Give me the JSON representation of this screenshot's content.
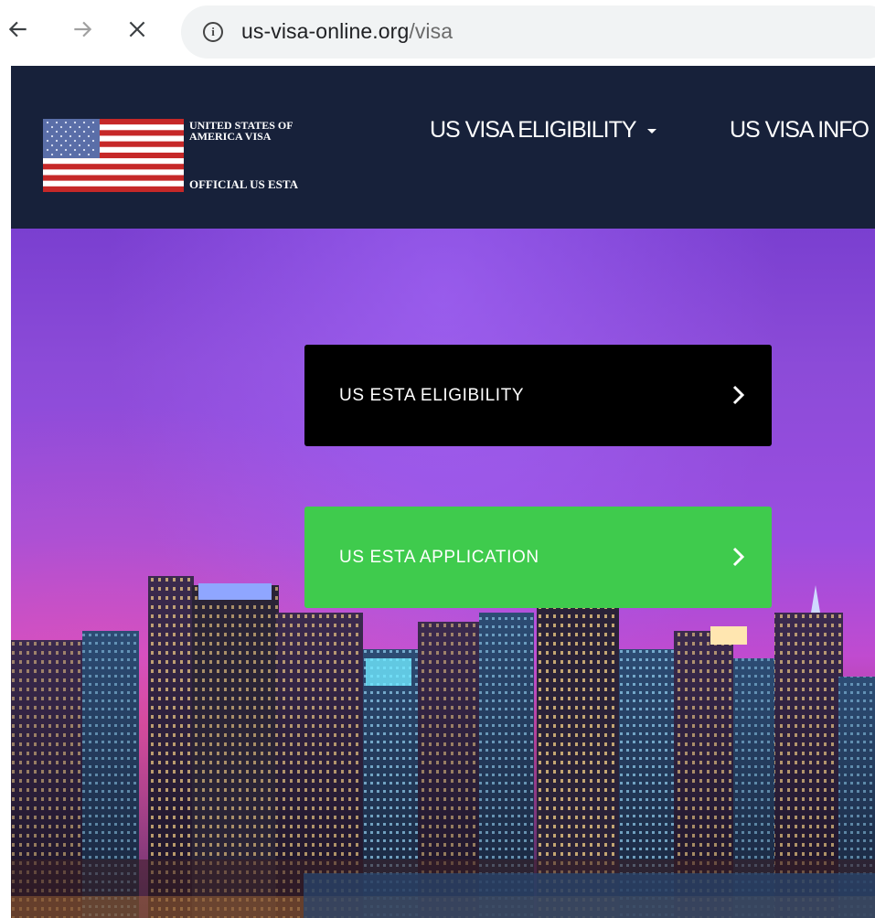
{
  "browser": {
    "url_host": "us-visa-online.org",
    "url_path": "/visa",
    "icons": [
      "back-arrow-icon",
      "forward-arrow-icon",
      "stop-icon",
      "info-icon"
    ]
  },
  "header": {
    "brand_line1": "UNITED STATES OF",
    "brand_line2": "AMERICA VISA",
    "brand_tagline": "OFFICIAL US ESTA",
    "nav": {
      "eligibility": "US VISA ELIGIBILITY",
      "info": "US VISA INFO"
    },
    "colors": {
      "background": "#17213a"
    }
  },
  "hero": {
    "eligibility_button": "US ESTA ELIGIBILITY",
    "application_button": "US ESTA APPLICATION",
    "colors": {
      "eligibility": "#000000",
      "application": "#3fcb4d"
    }
  }
}
